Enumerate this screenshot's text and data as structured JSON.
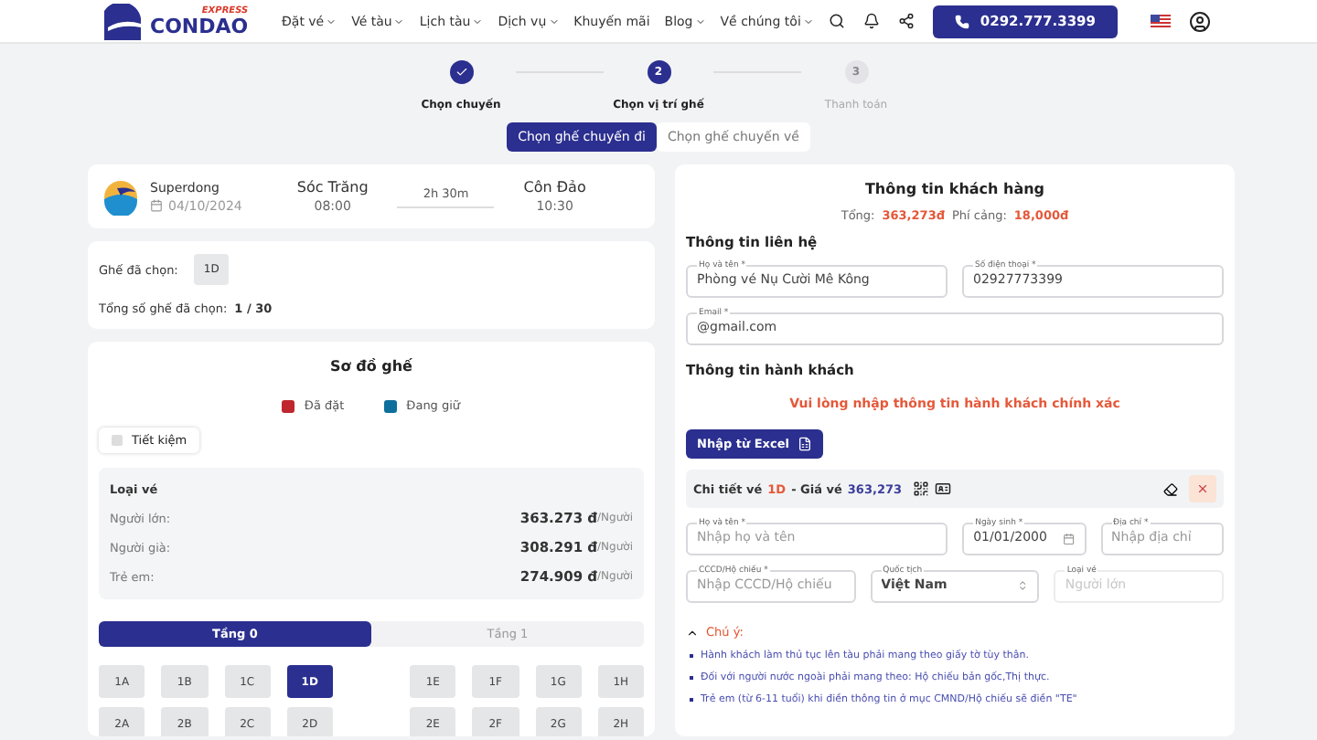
{
  "header": {
    "logo": {
      "word": "CONDAO",
      "tag": "EXPRESS"
    },
    "nav": [
      {
        "label": "Đặt vé",
        "dropdown": true
      },
      {
        "label": "Vé tàu",
        "dropdown": true
      },
      {
        "label": "Lịch tàu",
        "dropdown": true
      },
      {
        "label": "Dịch vụ",
        "dropdown": true
      },
      {
        "label": "Khuyến mãi",
        "dropdown": false
      },
      {
        "label": "Blog",
        "dropdown": true
      },
      {
        "label": "Về chúng tôi",
        "dropdown": true
      }
    ],
    "phone": "0292.777.3399"
  },
  "steps": [
    {
      "label": "Chọn chuyến",
      "completed": true,
      "reached": true
    },
    {
      "number": "2",
      "label": "Chọn vị trí ghế",
      "completed": false,
      "reached": true
    },
    {
      "number": "3",
      "label": "Thanh toán",
      "completed": false,
      "reached": false
    }
  ],
  "trip_tabs": [
    {
      "label": "Chọn ghế chuyến đi",
      "selected": true
    },
    {
      "label": "Chọn ghế chuyến về",
      "selected": false
    }
  ],
  "trip": {
    "operator": "Superdong",
    "date": "04/10/2024",
    "from": "Sóc Trăng",
    "depart": "08:00",
    "duration": "2h 30m",
    "to": "Côn Đảo",
    "arrive": "10:30"
  },
  "selection": {
    "seats_label": "Ghế đã chọn:",
    "seats": [
      "1D"
    ],
    "total_label": "Tổng số ghế đã chọn:",
    "total": "1 / 30"
  },
  "seat_map": {
    "title": "Sơ đồ ghế",
    "legend": [
      {
        "label": "Đã đặt",
        "color": "#c0262d"
      },
      {
        "label": "Đang giữ",
        "color": "#0d6f9c"
      }
    ],
    "filter": {
      "label": "Tiết kiệm",
      "checked": false
    },
    "fares_title": "Loại vé",
    "fares": [
      {
        "type": "Người lớn:",
        "price": "363.273 đ",
        "unit": "/Người"
      },
      {
        "type": "Người già:",
        "price": "308.291 đ",
        "unit": "/Người"
      },
      {
        "type": "Trẻ em:",
        "price": "274.909 đ",
        "unit": "/Người"
      }
    ],
    "decks": [
      {
        "label": "Tầng 0",
        "selected": true
      },
      {
        "label": "Tầng 1",
        "selected": false
      }
    ],
    "rows": [
      {
        "left": [
          {
            "label": "1A",
            "selected": false
          },
          {
            "label": "1B",
            "selected": false
          },
          {
            "label": "1C",
            "selected": false
          },
          {
            "label": "1D",
            "selected": true
          }
        ],
        "right": [
          {
            "label": "1E",
            "selected": false
          },
          {
            "label": "1F",
            "selected": false
          },
          {
            "label": "1G",
            "selected": false
          },
          {
            "label": "1H",
            "selected": false
          }
        ]
      },
      {
        "left": [
          {
            "label": "2A",
            "selected": false
          },
          {
            "label": "2B",
            "selected": false
          },
          {
            "label": "2C",
            "selected": false
          },
          {
            "label": "2D",
            "selected": false
          }
        ],
        "right": [
          {
            "label": "2E",
            "selected": false
          },
          {
            "label": "2F",
            "selected": false
          },
          {
            "label": "2G",
            "selected": false
          },
          {
            "label": "2H",
            "selected": false
          }
        ]
      }
    ]
  },
  "customer": {
    "title": "Thông tin khách hàng",
    "total_label": "Tổng:",
    "total": "363,273đ",
    "fee_label": "Phí cảng:",
    "fee": "18,000đ",
    "contact_title": "Thông tin liên hệ",
    "contact_fields": [
      {
        "label": "Họ và tên *",
        "value": "Phòng vé Nụ Cười Mê Kông"
      },
      {
        "label": "Số điện thoại *",
        "value": "02927773399"
      },
      {
        "label": "Email *",
        "value": "@gmail.com"
      }
    ],
    "passenger_title": "Thông tin hành khách",
    "warning": "Vui lòng nhập thông tin hành khách chính xác",
    "excel_button": "Nhập từ Excel",
    "ticket": {
      "label": "Chi tiết vé",
      "seat": "1D",
      "price_label": "- Giá vé",
      "price": "363,273"
    },
    "passenger_fields": [
      {
        "kind": "text",
        "label": "Họ và tên *",
        "placeholder": "Nhập họ và tên"
      },
      {
        "kind": "date",
        "label": "Ngày sinh *",
        "value": "01/01/2000"
      },
      {
        "kind": "text",
        "label": "Địa chỉ *",
        "placeholder": "Nhập địa chỉ"
      },
      {
        "kind": "text",
        "label": "CCCD/Hộ chiếu *",
        "placeholder": "Nhập CCCD/Hộ chiếu"
      },
      {
        "kind": "select",
        "label": "Quốc tịch",
        "value": "Việt Nam"
      },
      {
        "kind": "disabled",
        "label": "Loại vé",
        "placeholder": "Người lớn"
      }
    ],
    "notes": {
      "title": "Chú ý:",
      "expanded": true,
      "items": [
        "Hành khách làm thủ tục lên tàu phải mang theo giấy tờ tùy thân.",
        "Đối với người nước ngoài phải mang theo: Hộ chiếu bản gốc,Thị thực.",
        "Trẻ em (từ 6-11 tuổi) khi điền thông tin ở mục CMND/Hộ chiếu sẽ điền \"TE\""
      ]
    }
  }
}
